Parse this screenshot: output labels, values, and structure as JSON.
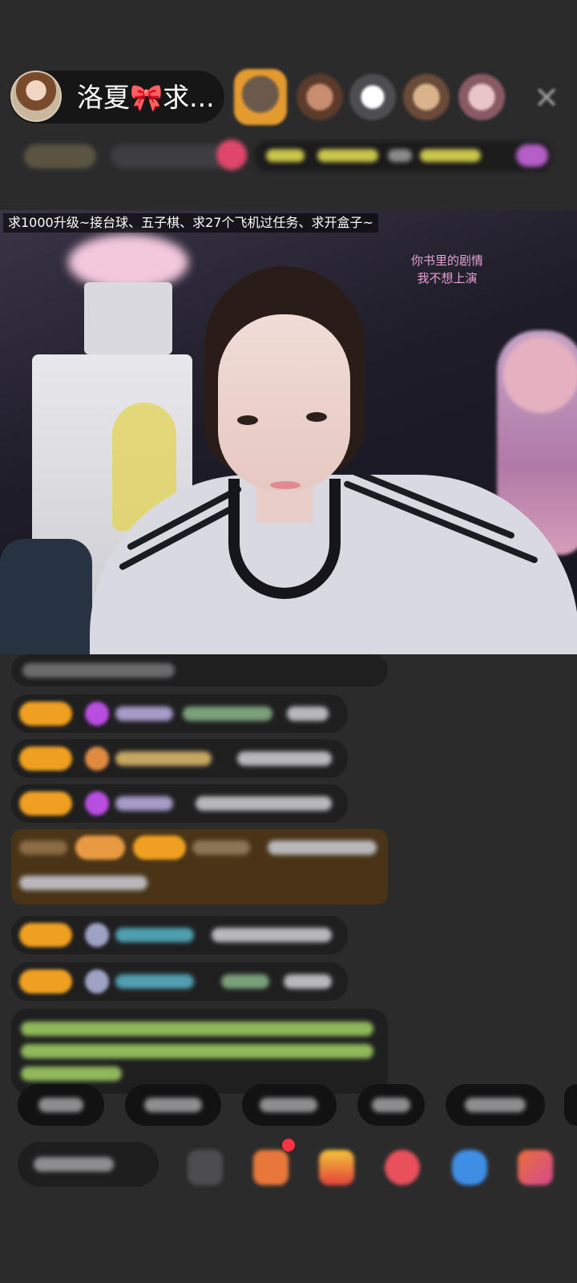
{
  "header": {
    "anchor_name": "洛夏🎀求...",
    "viewer_avatars": [
      "top-viewer-1",
      "viewer-2",
      "viewer-3",
      "viewer-4",
      "viewer-5"
    ],
    "close_icon": "close-icon"
  },
  "video": {
    "banner": "求1000升级~接台球、五子棋、求27个飞机过任务、求开盒子~",
    "lyric_line1": "你书里的剧情",
    "lyric_line2": "我不想上演"
  },
  "colors": {
    "background": "#2b2b2c",
    "chat_bubble": "#1f1f20",
    "gold_bubble": "#4a3418",
    "badge": "#f0a020",
    "lyric": "#e7a0d4"
  },
  "chat_messages": [
    "blurred",
    "blurred",
    "blurred",
    "blurred",
    "blurred",
    "blurred",
    "blurred",
    "blurred"
  ],
  "quick_replies": [
    "blurred",
    "blurred",
    "blurred",
    "blurred",
    "blurred"
  ],
  "toolbar_icons": [
    "share-icon",
    "gift-box-icon",
    "red-packet-icon",
    "lucky-bag-icon",
    "game-icon",
    "more-icon"
  ]
}
